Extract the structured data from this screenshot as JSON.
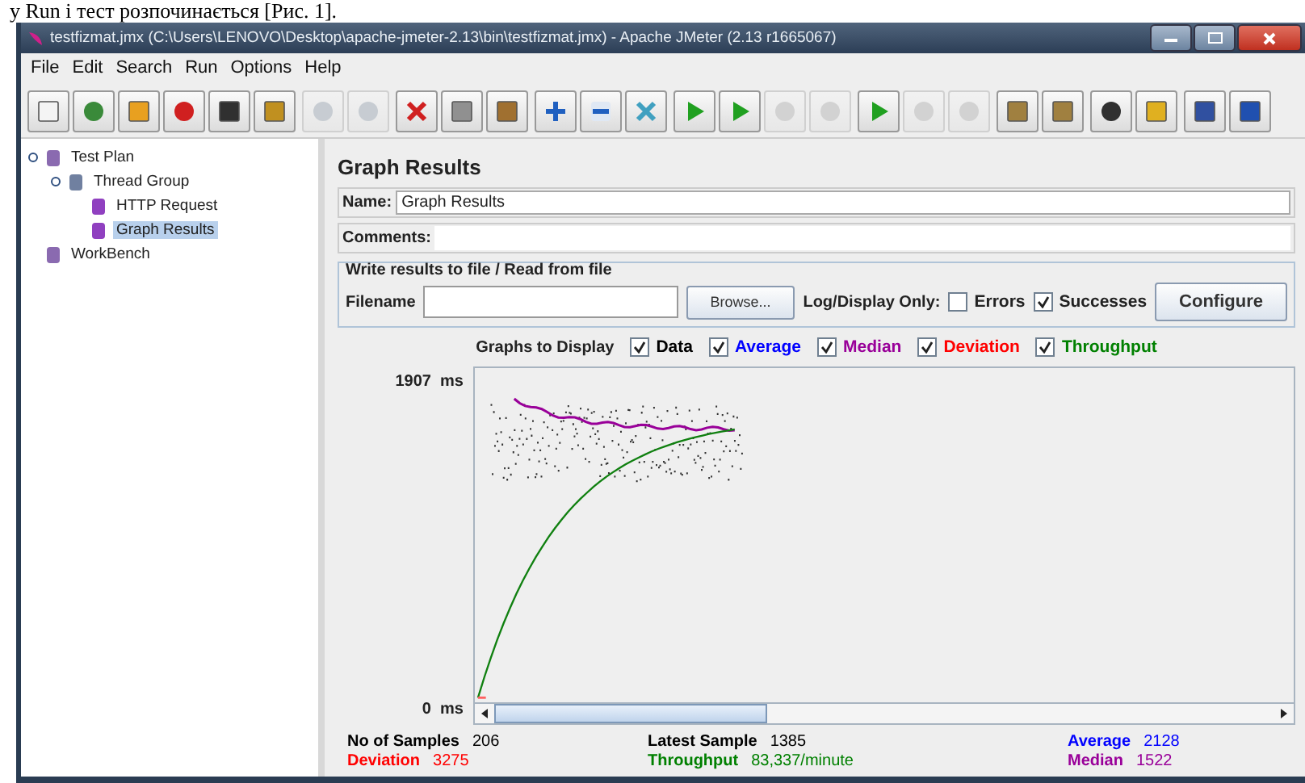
{
  "document_text": "у Run і тест розпочинається [Рис. 1].",
  "window": {
    "title": "testfizmat.jmx (C:\\Users\\LENOVO\\Desktop\\apache-jmeter-2.13\\bin\\testfizmat.jmx) - Apache JMeter (2.13 r1665067)"
  },
  "menu": [
    "File",
    "Edit",
    "Search",
    "Run",
    "Options",
    "Help"
  ],
  "toolbar": [
    [
      {
        "disabled": false
      },
      {
        "disabled": false
      },
      {
        "disabled": false
      },
      {
        "disabled": false
      },
      {
        "disabled": false
      },
      {
        "disabled": false
      }
    ],
    [
      {
        "disabled": true
      },
      {
        "disabled": true
      }
    ],
    [
      {
        "disabled": false
      },
      {
        "disabled": false
      },
      {
        "disabled": false
      }
    ],
    [
      {
        "disabled": false
      },
      {
        "disabled": false
      },
      {
        "disabled": false
      }
    ],
    [
      {
        "disabled": false
      },
      {
        "disabled": false
      },
      {
        "disabled": true
      },
      {
        "disabled": true
      }
    ],
    [
      {
        "disabled": false
      },
      {
        "disabled": true
      },
      {
        "disabled": true
      }
    ],
    [
      {
        "disabled": false
      },
      {
        "disabled": false
      }
    ],
    [
      {
        "disabled": false
      },
      {
        "disabled": false
      }
    ],
    [
      {
        "disabled": false
      },
      {
        "disabled": false
      }
    ]
  ],
  "tree": [
    {
      "label": "Test Plan",
      "expanded": true,
      "selected": false,
      "children": [
        {
          "label": "Thread Group",
          "expanded": true,
          "selected": false,
          "children": [
            {
              "label": "HTTP Request",
              "selected": false
            },
            {
              "label": "Graph Results",
              "selected": true
            }
          ]
        }
      ]
    },
    {
      "label": "WorkBench",
      "selected": false
    }
  ],
  "panel": {
    "title": "Graph Results",
    "name_label": "Name:",
    "name_value": "Graph Results",
    "comments_label": "Comments:",
    "file_group": {
      "title": "Write results to file / Read from file",
      "filename_label": "Filename",
      "browse_button": "Browse...",
      "log_label": "Log/Display Only:",
      "options": [
        {
          "label": "Errors",
          "checked": false
        },
        {
          "label": "Successes",
          "checked": true
        }
      ],
      "configure_button": "Configure"
    },
    "graphs": {
      "label": "Graphs to Display",
      "options": [
        {
          "label": "Data",
          "checked": true,
          "color": "#000000"
        },
        {
          "label": "Average",
          "checked": true,
          "color": "#0000ff"
        },
        {
          "label": "Median",
          "checked": true,
          "color": "#990099"
        },
        {
          "label": "Deviation",
          "checked": true,
          "color": "#ff0000"
        },
        {
          "label": "Throughput",
          "checked": true,
          "color": "#008000"
        }
      ]
    },
    "graph": {
      "y_top": "1907  ms",
      "y_bottom": "0  ms"
    },
    "stats": [
      {
        "label": "No of Samples",
        "value": "206",
        "color": "#000000"
      },
      {
        "label": "Latest Sample",
        "value": "1385",
        "color": "#000000"
      },
      {
        "label": "Average",
        "value": "2128",
        "color": "#0000ff"
      },
      {
        "label": "Deviation",
        "value": "3275",
        "color": "#ff0000"
      },
      {
        "label": "Throughput",
        "value": "83,337/minute",
        "color": "#008000"
      },
      {
        "label": "Median",
        "value": "1522",
        "color": "#990099"
      }
    ]
  }
}
